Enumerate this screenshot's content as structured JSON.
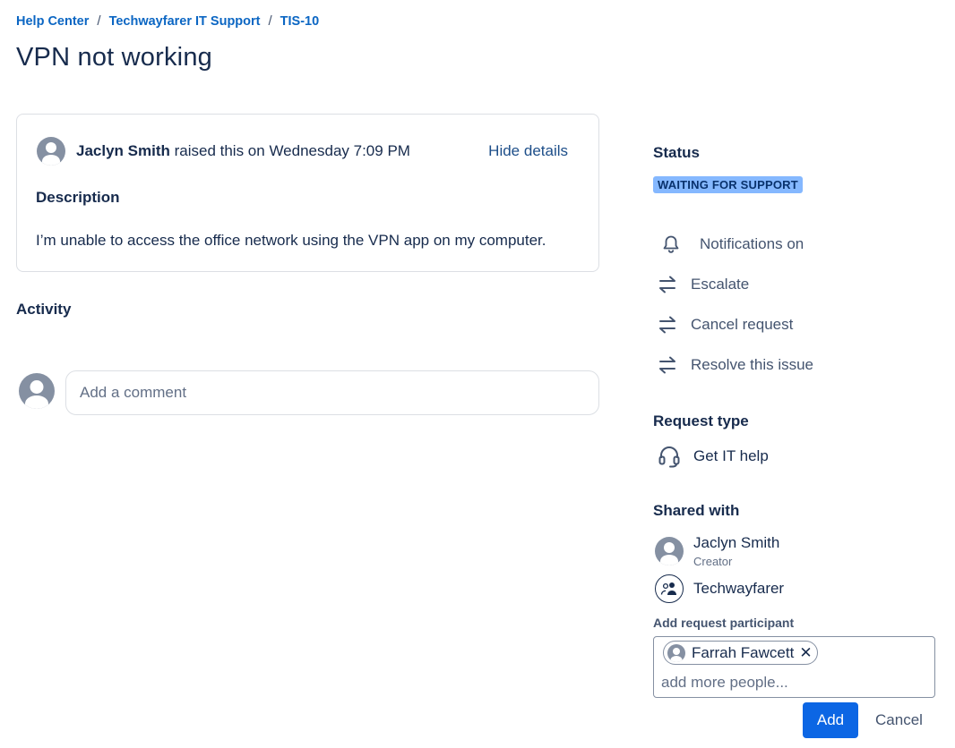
{
  "breadcrumb": {
    "items": [
      "Help Center",
      "Techwayfarer IT Support",
      "TIS-10"
    ],
    "separator": "/"
  },
  "page_title": "VPN not working",
  "request": {
    "reporter": "Jaclyn Smith",
    "raised_text": "raised this on Wednesday 7:09 PM",
    "hide_details": "Hide details",
    "description_heading": "Description",
    "description_text": "I’m unable to access the office network using the VPN app on my computer."
  },
  "activity": {
    "heading": "Activity",
    "comment_placeholder": "Add a comment"
  },
  "sidebar": {
    "status_heading": "Status",
    "status_value": "WAITING FOR SUPPORT",
    "actions": [
      {
        "icon": "bell-icon",
        "label": "Notifications on"
      },
      {
        "icon": "transition-arrows-icon",
        "label": "Escalate"
      },
      {
        "icon": "transition-arrows-icon",
        "label": "Cancel request"
      },
      {
        "icon": "transition-arrows-icon",
        "label": "Resolve this issue"
      }
    ],
    "request_type_heading": "Request type",
    "request_type": {
      "icon": "headset-icon",
      "label": "Get IT help"
    },
    "shared_heading": "Shared with",
    "shared": [
      {
        "name": "Jaclyn Smith",
        "role": "Creator",
        "icon": "user-avatar-icon"
      },
      {
        "name": "Techwayfarer",
        "icon": "organization-icon"
      }
    ],
    "participant_label": "Add request participant",
    "participant_chip": "Farrah Fawcett",
    "participant_chip_remove": "✕",
    "participant_placeholder": "add more people...",
    "add_button": "Add",
    "cancel_button": "Cancel"
  },
  "colors": {
    "link": "#0b66c3",
    "status_bg": "#85b8ff",
    "status_text": "#09326c",
    "primary_button": "#0c66e4"
  }
}
